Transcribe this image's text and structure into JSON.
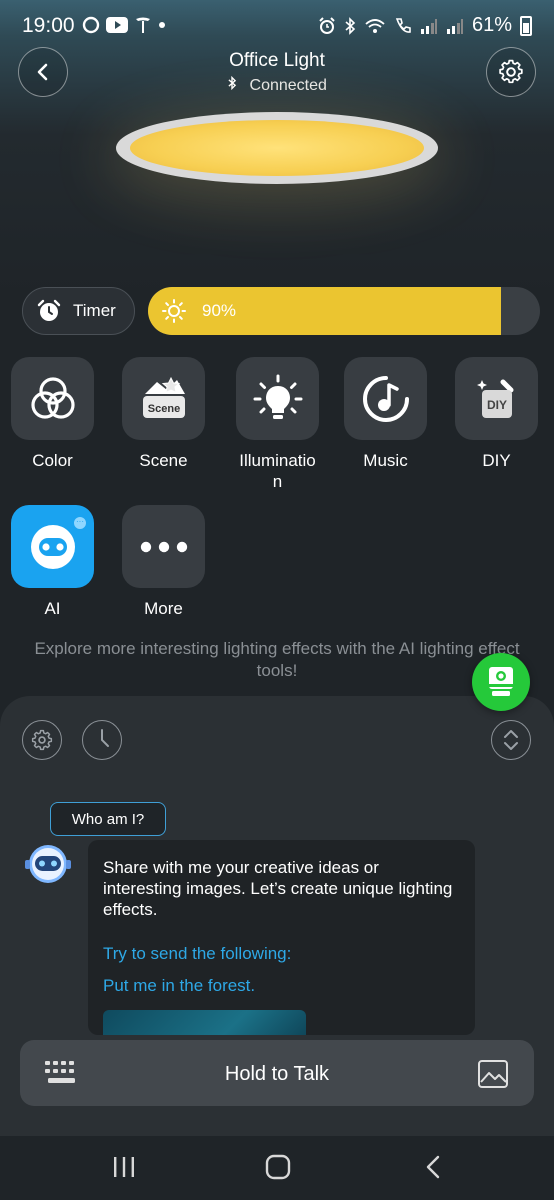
{
  "status_bar": {
    "time": "19:00",
    "battery": "61%",
    "left_icons": [
      "ring-icon",
      "youtube-icon",
      "tesla-icon",
      "dot-icon"
    ],
    "right_icons": [
      "alarm-icon",
      "bluetooth-icon",
      "wifi-icon",
      "call-icon",
      "signal-icon",
      "signal-icon"
    ]
  },
  "header": {
    "title": "Office Light",
    "connection_status": "Connected"
  },
  "controls": {
    "timer_label": "Timer",
    "brightness_label": "90%",
    "brightness_value": 0.9,
    "brightness_color": "#ebc530"
  },
  "modes": [
    {
      "label": "Color",
      "icon": "color-circles-icon"
    },
    {
      "label": "Scene",
      "icon": "scene-icon",
      "icon_text": "Scene"
    },
    {
      "label": "Illuminatio\nn",
      "icon": "bulb-icon"
    },
    {
      "label": "Music",
      "icon": "music-icon"
    },
    {
      "label": "DIY",
      "icon": "diy-icon",
      "icon_text": "DIY"
    },
    {
      "label": "AI",
      "icon": "robot-icon",
      "accent": "#1aa3f0"
    },
    {
      "label": "More",
      "icon": "more-dots-icon"
    }
  ],
  "explore_text": "Explore more interesting lighting effects with the AI lighting effect tools!",
  "chat": {
    "who_am_i": "Who am I?",
    "message": "Share with me your creative ideas or interesting images. Let’s create unique lighting effects.",
    "try_label": "Try to send the following:",
    "suggestion": "Put me in the forest.",
    "link_color": "#2ea8e6"
  },
  "input": {
    "hold_to_talk": "Hold to Talk"
  },
  "colors": {
    "float_button": "#25c93a",
    "background": "#1f2428"
  }
}
